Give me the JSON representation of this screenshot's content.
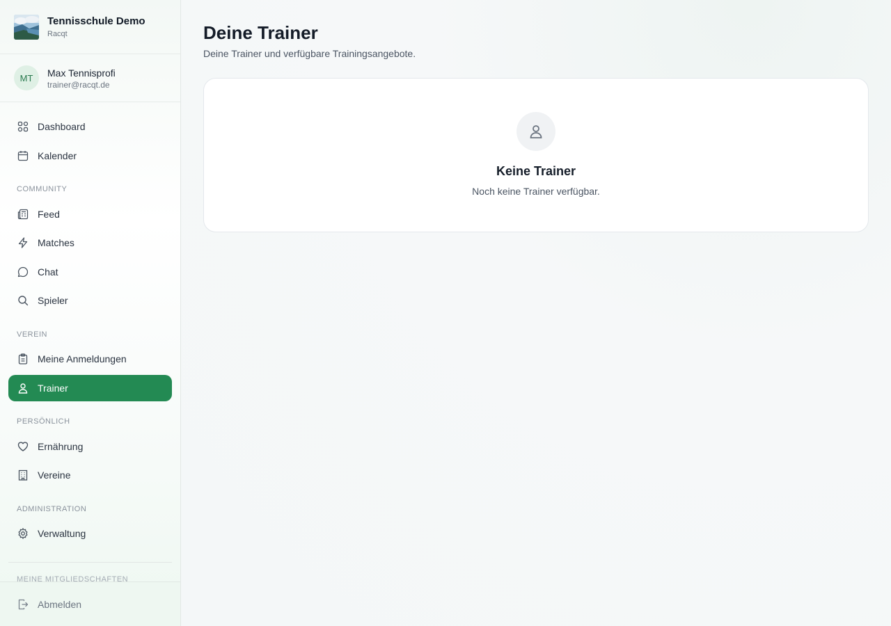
{
  "brand": {
    "name": "Tennisschule Demo",
    "subtitle": "Racqt"
  },
  "user": {
    "initials": "MT",
    "name": "Max Tennisprofi",
    "email": "trainer@racqt.de"
  },
  "nav": {
    "dashboard": {
      "label": "Dashboard",
      "icon": "grid-icon"
    },
    "kalender": {
      "label": "Kalender",
      "icon": "calendar-icon"
    },
    "section_community": "COMMUNITY",
    "feed": {
      "label": "Feed",
      "icon": "newspaper-icon"
    },
    "matches": {
      "label": "Matches",
      "icon": "lightning-icon"
    },
    "chat": {
      "label": "Chat",
      "icon": "message-icon"
    },
    "spieler": {
      "label": "Spieler",
      "icon": "search-icon"
    },
    "section_verein": "VEREIN",
    "anmeldungen": {
      "label": "Meine Anmeldungen",
      "icon": "clipboard-icon"
    },
    "trainer": {
      "label": "Trainer",
      "icon": "user-icon",
      "active": true
    },
    "section_persoenlich": "PERSÖNLICH",
    "ernaehrung": {
      "label": "Ernährung",
      "icon": "heart-icon"
    },
    "vereine": {
      "label": "Vereine",
      "icon": "building-icon"
    },
    "section_admin": "ADMINISTRATION",
    "verwaltung": {
      "label": "Verwaltung",
      "icon": "gear-icon"
    },
    "section_mitgliedschaften": "MEINE MITGLIEDSCHAFTEN",
    "logout": {
      "label": "Abmelden",
      "icon": "logout-icon"
    }
  },
  "page": {
    "title": "Deine Trainer",
    "subtitle": "Deine Trainer und verfügbare Trainingsangebote."
  },
  "empty_state": {
    "icon": "user-icon",
    "title": "Keine Trainer",
    "text": "Noch keine Trainer verfügbar."
  },
  "colors": {
    "accent": "#238a53",
    "avatar_bg": "#dff0e5"
  }
}
